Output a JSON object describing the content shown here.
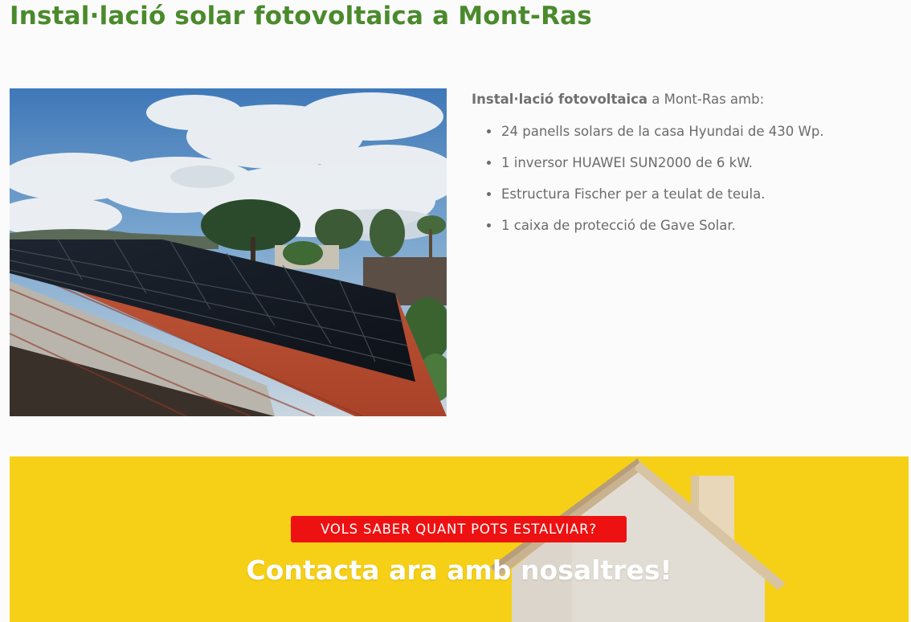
{
  "page": {
    "title": "Instal·lació solar fotovoltaica a Mont-Ras"
  },
  "installation": {
    "intro_bold": "Instal·lació fotovoltaica",
    "intro_rest": " a Mont-Ras amb:",
    "items": [
      "24 panells solars de la casa Hyundai de 430 Wp.",
      "1 inversor HUAWEI SUN2000 de 6 kW.",
      "Estructura Fischer per a teulat de teula.",
      "1 caixa de protecció de Gave Solar."
    ]
  },
  "cta": {
    "badge": "VOLS SABER QUANT POTS ESTALVIAR?",
    "heading": "Contacta ara amb nosaltres!"
  },
  "colors": {
    "title_green": "#4a8a2c",
    "cta_yellow": "#f6d016",
    "badge_red": "#ee1111",
    "text_gray": "#6b6b6b"
  }
}
